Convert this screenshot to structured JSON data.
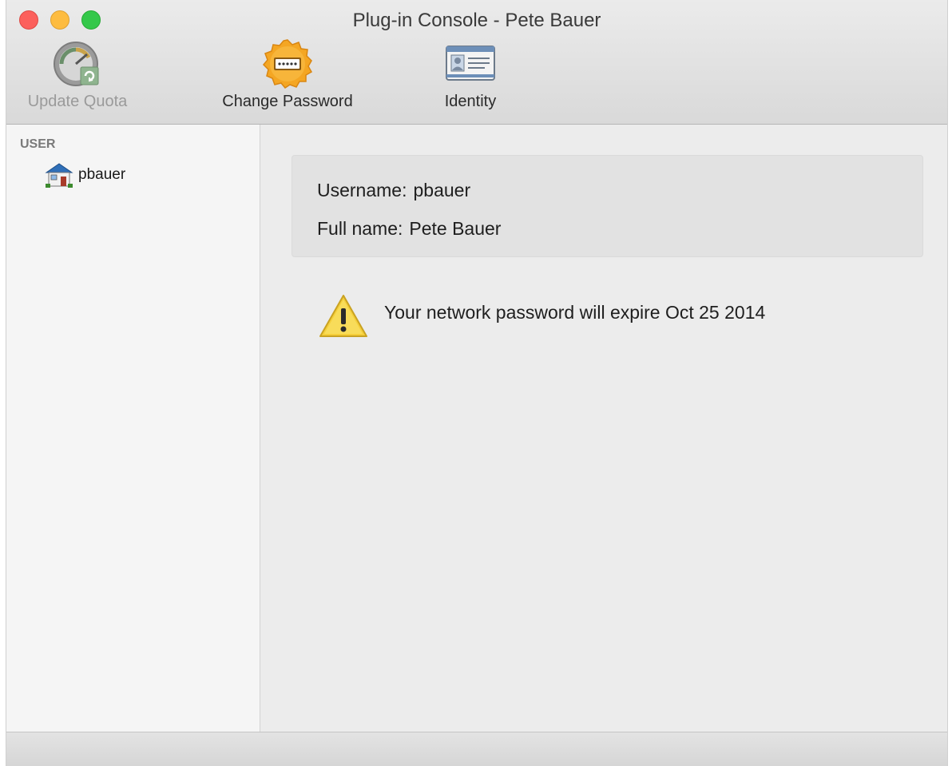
{
  "window": {
    "title": "Plug-in Console - Pete Bauer"
  },
  "toolbar": {
    "update_quota": {
      "label": "Update Quota",
      "icon": "gauge-refresh-icon",
      "enabled": false
    },
    "change_password": {
      "label": "Change Password",
      "icon": "password-badge-icon",
      "enabled": true
    },
    "identity": {
      "label": "Identity",
      "icon": "id-card-icon",
      "enabled": true
    }
  },
  "sidebar": {
    "heading": "USER",
    "items": [
      {
        "label": "pbauer",
        "icon": "home-icon"
      }
    ]
  },
  "info": {
    "username_label": "Username:",
    "username_value": "pbauer",
    "fullname_label": "Full name:",
    "fullname_value": "Pete Bauer"
  },
  "warning": {
    "icon": "warning-icon",
    "message": "Your network password will expire Oct 25 2014"
  },
  "colors": {
    "close": "#fc605c",
    "minimize": "#fdbc40",
    "maximize": "#34c84a",
    "warning": "#f5cf3a",
    "password_badge": "#f4a623"
  }
}
